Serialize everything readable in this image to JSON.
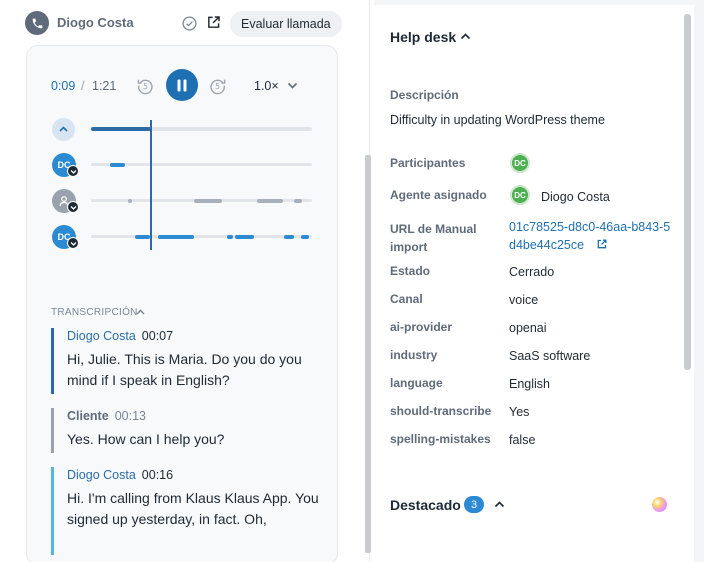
{
  "call": {
    "caller_name": "Diogo Costa",
    "evaluate_label": "Evaluar llamada",
    "icons": [
      "phone-icon",
      "check-circle-icon",
      "external-link-icon"
    ]
  },
  "player": {
    "current_time": "0:09",
    "separator": "/",
    "total_time": "1:21",
    "skip_back_label": "5",
    "skip_forward_label": "5",
    "speed": "1.0×",
    "progress": 0.11,
    "lanes": [
      {
        "initials": "DC",
        "color": "#2b8ad1"
      },
      {
        "initials": "",
        "color": "#9aa3ad"
      },
      {
        "initials": "DC",
        "color": "#2b8ad1"
      }
    ]
  },
  "transcription": {
    "title": "TRANSCRIPCIÓN",
    "messages": [
      {
        "speaker": "Diogo Costa",
        "time": "00:07",
        "text": "Hi, Julie. This is Maria. Do you do you mind if I speak in English?",
        "color": "#2b6ca8"
      },
      {
        "speaker": "Cliente",
        "time": "00:13",
        "text": "Yes. How can I help you?",
        "color": "#9aa3ad"
      },
      {
        "speaker": "Diogo Costa",
        "time": "00:16",
        "text": "Hi. I'm calling from Klaus Klaus App. You signed up yesterday, in fact. Oh,",
        "color": "#56b6e0"
      }
    ]
  },
  "helpdesk": {
    "title": "Help desk",
    "description_label": "Descripción",
    "description": "Difficulty in updating WordPress theme",
    "participants_label": "Participantes",
    "participant_initials": "DC",
    "agent_label": "Agente asignado",
    "agent_initials": "DC",
    "agent_name": "Diogo Costa",
    "url_label": "URL de Manual import",
    "url_value": "01c78525-d8c0-46aa-b843-5d4be44c25ce",
    "fields": [
      {
        "label": "Estado",
        "value": "Cerrado"
      },
      {
        "label": "Canal",
        "value": "voice"
      },
      {
        "label": "ai-provider",
        "value": "openai"
      },
      {
        "label": "industry",
        "value": "SaaS software"
      },
      {
        "label": "language",
        "value": "English"
      },
      {
        "label": "should-transcribe",
        "value": "Yes"
      },
      {
        "label": "spelling-mistakes",
        "value": "false"
      }
    ]
  },
  "destacado": {
    "title": "Destacado",
    "count": "3"
  }
}
